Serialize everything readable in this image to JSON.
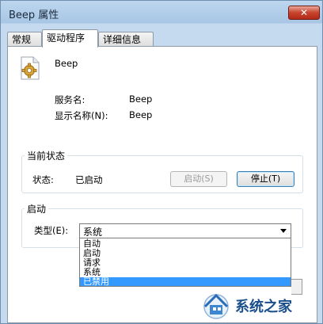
{
  "window": {
    "title": "Beep 属性",
    "close_label": "✕"
  },
  "tabs": [
    {
      "label": "常规"
    },
    {
      "label": "驱动程序"
    },
    {
      "label": "详细信息"
    }
  ],
  "service": {
    "icon": "gear-icon",
    "name": "Beep",
    "service_name_label": "服务名:",
    "service_name_value": "Beep",
    "display_name_label": "显示名称(N):",
    "display_name_value": "Beep"
  },
  "current_status": {
    "group_title": "当前状态",
    "status_label": "状态:",
    "status_value": "已启动",
    "start_button": "启动(S)",
    "stop_button": "停止(T)"
  },
  "startup": {
    "group_title": "启动",
    "type_label": "类型(E):",
    "type_value": "系统",
    "options": [
      "自动",
      "启动",
      "请求",
      "系统",
      "已禁用"
    ],
    "highlighted_option": "已禁用"
  },
  "watermark": {
    "text": "系统之家"
  },
  "colors": {
    "selection": "#3399ff",
    "close_button": "#c8432c",
    "watermark_text": "#1a4f8c"
  }
}
